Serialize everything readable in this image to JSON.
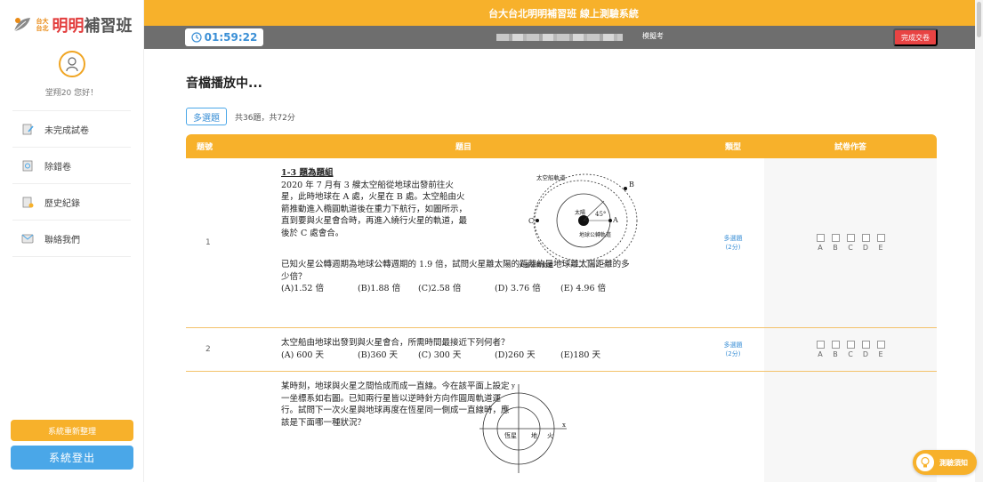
{
  "sidebar": {
    "logo": {
      "small_top": "台大",
      "small_bottom": "台北",
      "name_red": "明明",
      "name_dark": "補習班"
    },
    "greeting": "堂翔20 您好！",
    "menu": [
      {
        "label": "未完成試卷",
        "icon": "edit-doc-icon"
      },
      {
        "label": "除錯卷",
        "icon": "error-doc-icon"
      },
      {
        "label": "歷史紀錄",
        "icon": "history-doc-icon"
      },
      {
        "label": "聯絡我們",
        "icon": "contact-icon"
      }
    ],
    "rebuild_label": "系統重新整理",
    "logout_label": "系統登出"
  },
  "header": {
    "title": "台大台北明明補習班 線上測驗系統",
    "timer": "01:59:22",
    "examinee_label": "模擬考",
    "submit_label": "完成交卷"
  },
  "main": {
    "page_title": "音檔播放中...",
    "tab_label": "多選題",
    "count_text": "共36題，共72分",
    "columns": {
      "num": "題號",
      "question": "題目",
      "type": "類型",
      "answer": "試卷作答"
    },
    "options": [
      "A",
      "B",
      "C",
      "D",
      "E"
    ],
    "questions": [
      {
        "num": "1",
        "group_title": "1-3 題為題組",
        "stem": "2020 年 7 月有 3 艘太空船從地球出發前往火星，此時地球在 A 處，火星在 B 處。太空船由火箭推動進入橢圓軌道後在重力下航行，如圖所示，直到要與火星會合時，再進入繞行火星的軌道，最後於 C 處會合。",
        "question": "已知火星公轉週期為地球公轉週期的 1.9 倍，試問火星離太陽的距離約是地球離太陽距離的多少倍？",
        "choices": [
          "(A)1.52 倍",
          "(B)1.88 倍",
          "(C)2.58 倍",
          "(D) 3.76 倍",
          "(E) 4.96 倍"
        ],
        "figure_labels": {
          "ship_orbit": "太空船軌道",
          "sun": "太陽",
          "earth_orbit": "地球公轉軌道",
          "mars_orbit": "火星公轉軌道",
          "angle": "45°",
          "A": "A",
          "B": "B",
          "C": "C"
        },
        "type": "多選題",
        "score": "(2分)"
      },
      {
        "num": "2",
        "question": "太空船由地球出發到與火星會合，所需時間最接近下列何者？",
        "choices": [
          "(A) 600 天",
          "(B)360 天",
          "(C) 300 天",
          "(D)260 天",
          "(E)180 天"
        ],
        "type": "多選題",
        "score": "(2分)"
      },
      {
        "num": "",
        "question": "某時刻，地球與火星之間恰成而成一直線。今在該平面上設定一坐標系如右圖。已知兩行星皆以逆時針方向作圓周軌道運行。試問下一次火星與地球再度在恆星同一側成一直線時，應該是下面哪一種狀況？",
        "figure_labels": {
          "y": "y",
          "x": "x",
          "star": "恆星",
          "earth": "地",
          "mars": "火"
        },
        "type": "",
        "score": ""
      }
    ]
  },
  "notice_label": "測驗須知",
  "colors": {
    "accent": "#f7b12b",
    "blue": "#4aa7e8",
    "red": "#e84343",
    "subbar": "#6e6e6e"
  }
}
